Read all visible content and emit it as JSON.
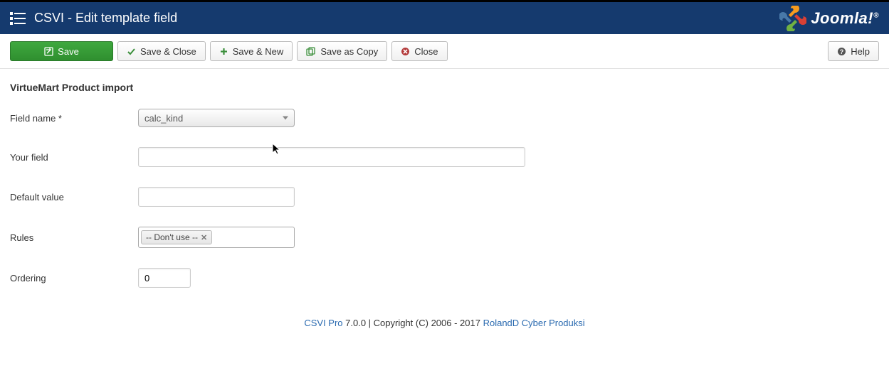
{
  "header": {
    "title": "CSVI - Edit template field",
    "brand": "Joomla!",
    "brand_reg": "®"
  },
  "toolbar": {
    "save": "Save",
    "save_close": "Save & Close",
    "save_new": "Save & New",
    "save_copy": "Save as Copy",
    "close": "Close",
    "help": "Help"
  },
  "form": {
    "section_title": "VirtueMart Product import",
    "labels": {
      "field_name": "Field name *",
      "your_field": "Your field",
      "default_value": "Default value",
      "rules": "Rules",
      "ordering": "Ordering"
    },
    "values": {
      "field_name": "calc_kind",
      "your_field": "",
      "default_value": "",
      "rules_tag": "-- Don't use --",
      "ordering": "0"
    }
  },
  "footer": {
    "link1": "CSVI Pro",
    "mid": " 7.0.0 | Copyright (C) 2006 - 2017 ",
    "link2": "RolandD Cyber Produksi"
  }
}
